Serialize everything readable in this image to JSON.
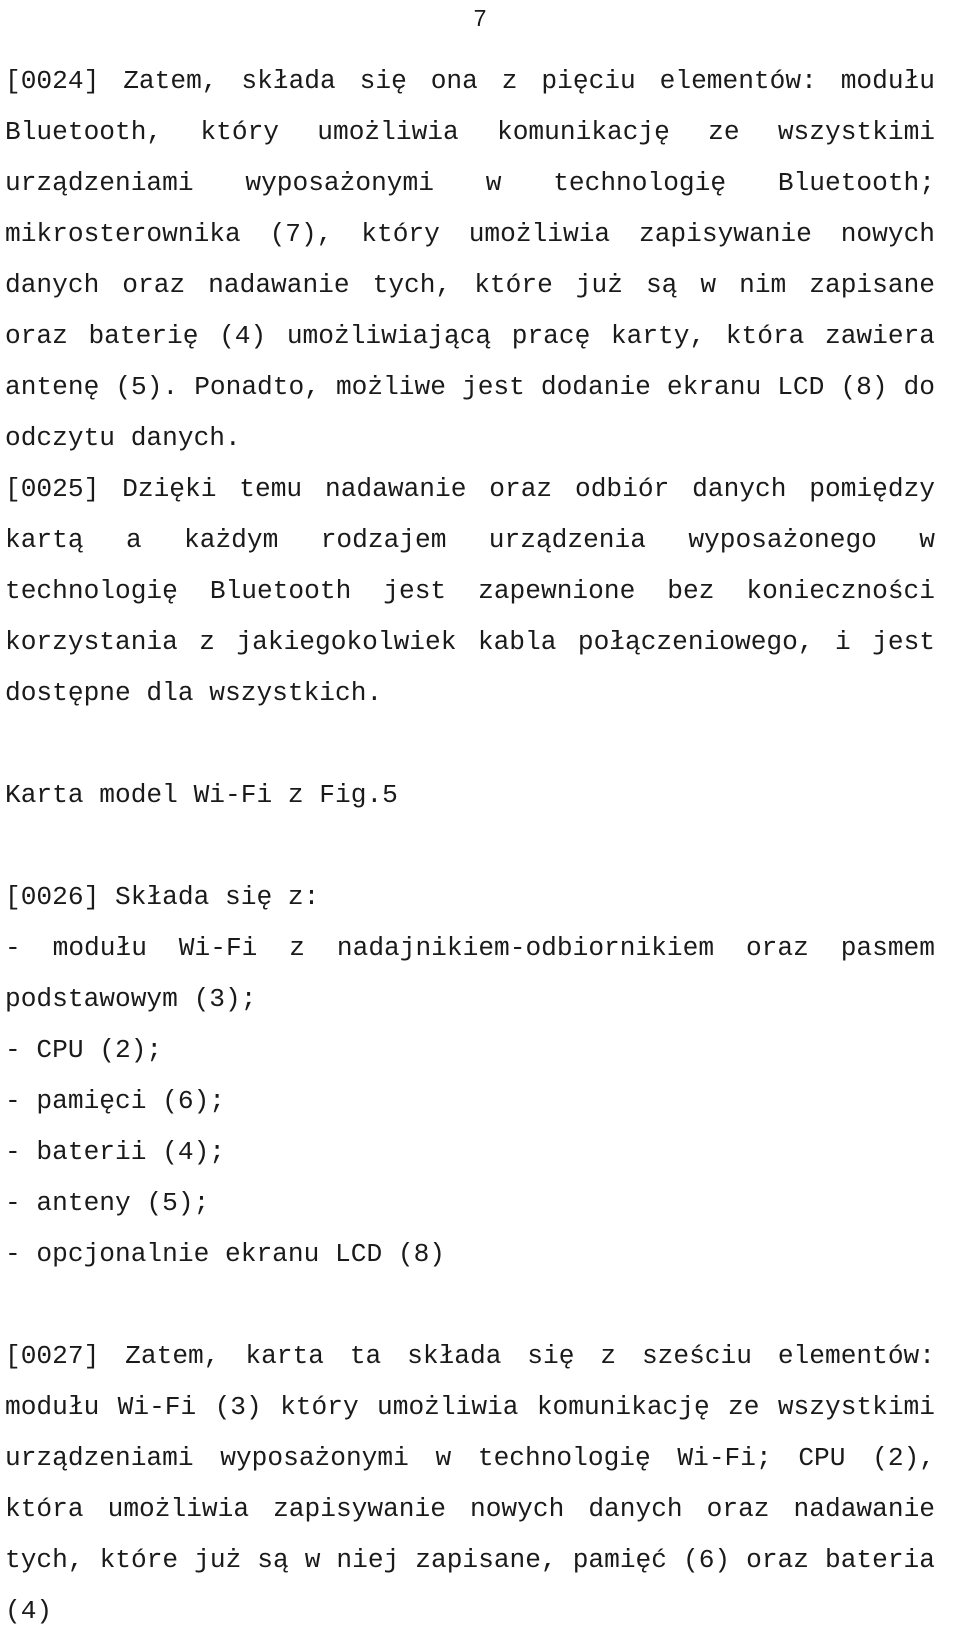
{
  "document": {
    "page_number": "7",
    "language": "pl",
    "blocks": [
      {
        "id": "para-0024",
        "type": "paragraph",
        "marker": "[0024]",
        "text": "[0024] Zatem, składa się ona z pięciu elementów: modułu Bluetooth, który umożliwia komunikację ze wszystkimi urządzeniami wyposażonymi w technologię Bluetooth; mikrosterownika (7), który umożliwia zapisywanie nowych danych oraz nadawanie tych, które już są w nim zapisane oraz baterię (4) umożliwiającą pracę karty, która zawiera antenę (5). Ponadto, możliwe jest dodanie ekranu LCD (8) do odczytu danych."
      },
      {
        "id": "para-0025",
        "type": "paragraph",
        "marker": "[0025]",
        "text": "[0025] Dzięki temu nadawanie oraz odbiór danych pomiędzy kartą a każdym rodzajem urządzenia wyposażonego w technologię Bluetooth jest zapewnione bez konieczności korzystania z jakiegokolwiek kabla połączeniowego, i jest dostępne dla wszystkich."
      },
      {
        "id": "heading-wifi",
        "type": "heading",
        "text": "Karta model Wi-Fi z Fig.5"
      },
      {
        "id": "para-0026",
        "type": "paragraph",
        "marker": "[0026]",
        "text": "[0026] Składa się z:"
      },
      {
        "id": "list-components",
        "type": "list",
        "items": [
          "- modułu Wi-Fi z nadajnikiem-odbiornikiem oraz pasmem podstawowym (3);",
          "- CPU (2);",
          "- pamięci (6);",
          "- baterii (4);",
          "- anteny (5);",
          "- opcjonalnie ekranu LCD (8)"
        ]
      },
      {
        "id": "para-0027",
        "type": "paragraph",
        "marker": "[0027]",
        "text": "[0027] Zatem, karta ta składa się z sześciu elementów: modułu Wi-Fi (3) który umożliwia komunikację ze wszystkimi urządzeniami wyposażonymi w technologię Wi-Fi; CPU (2), która umożliwia zapisywanie nowych danych oraz nadawanie tych, które już są w niej zapisane, pamięć (6) oraz bateria (4)"
      }
    ]
  }
}
